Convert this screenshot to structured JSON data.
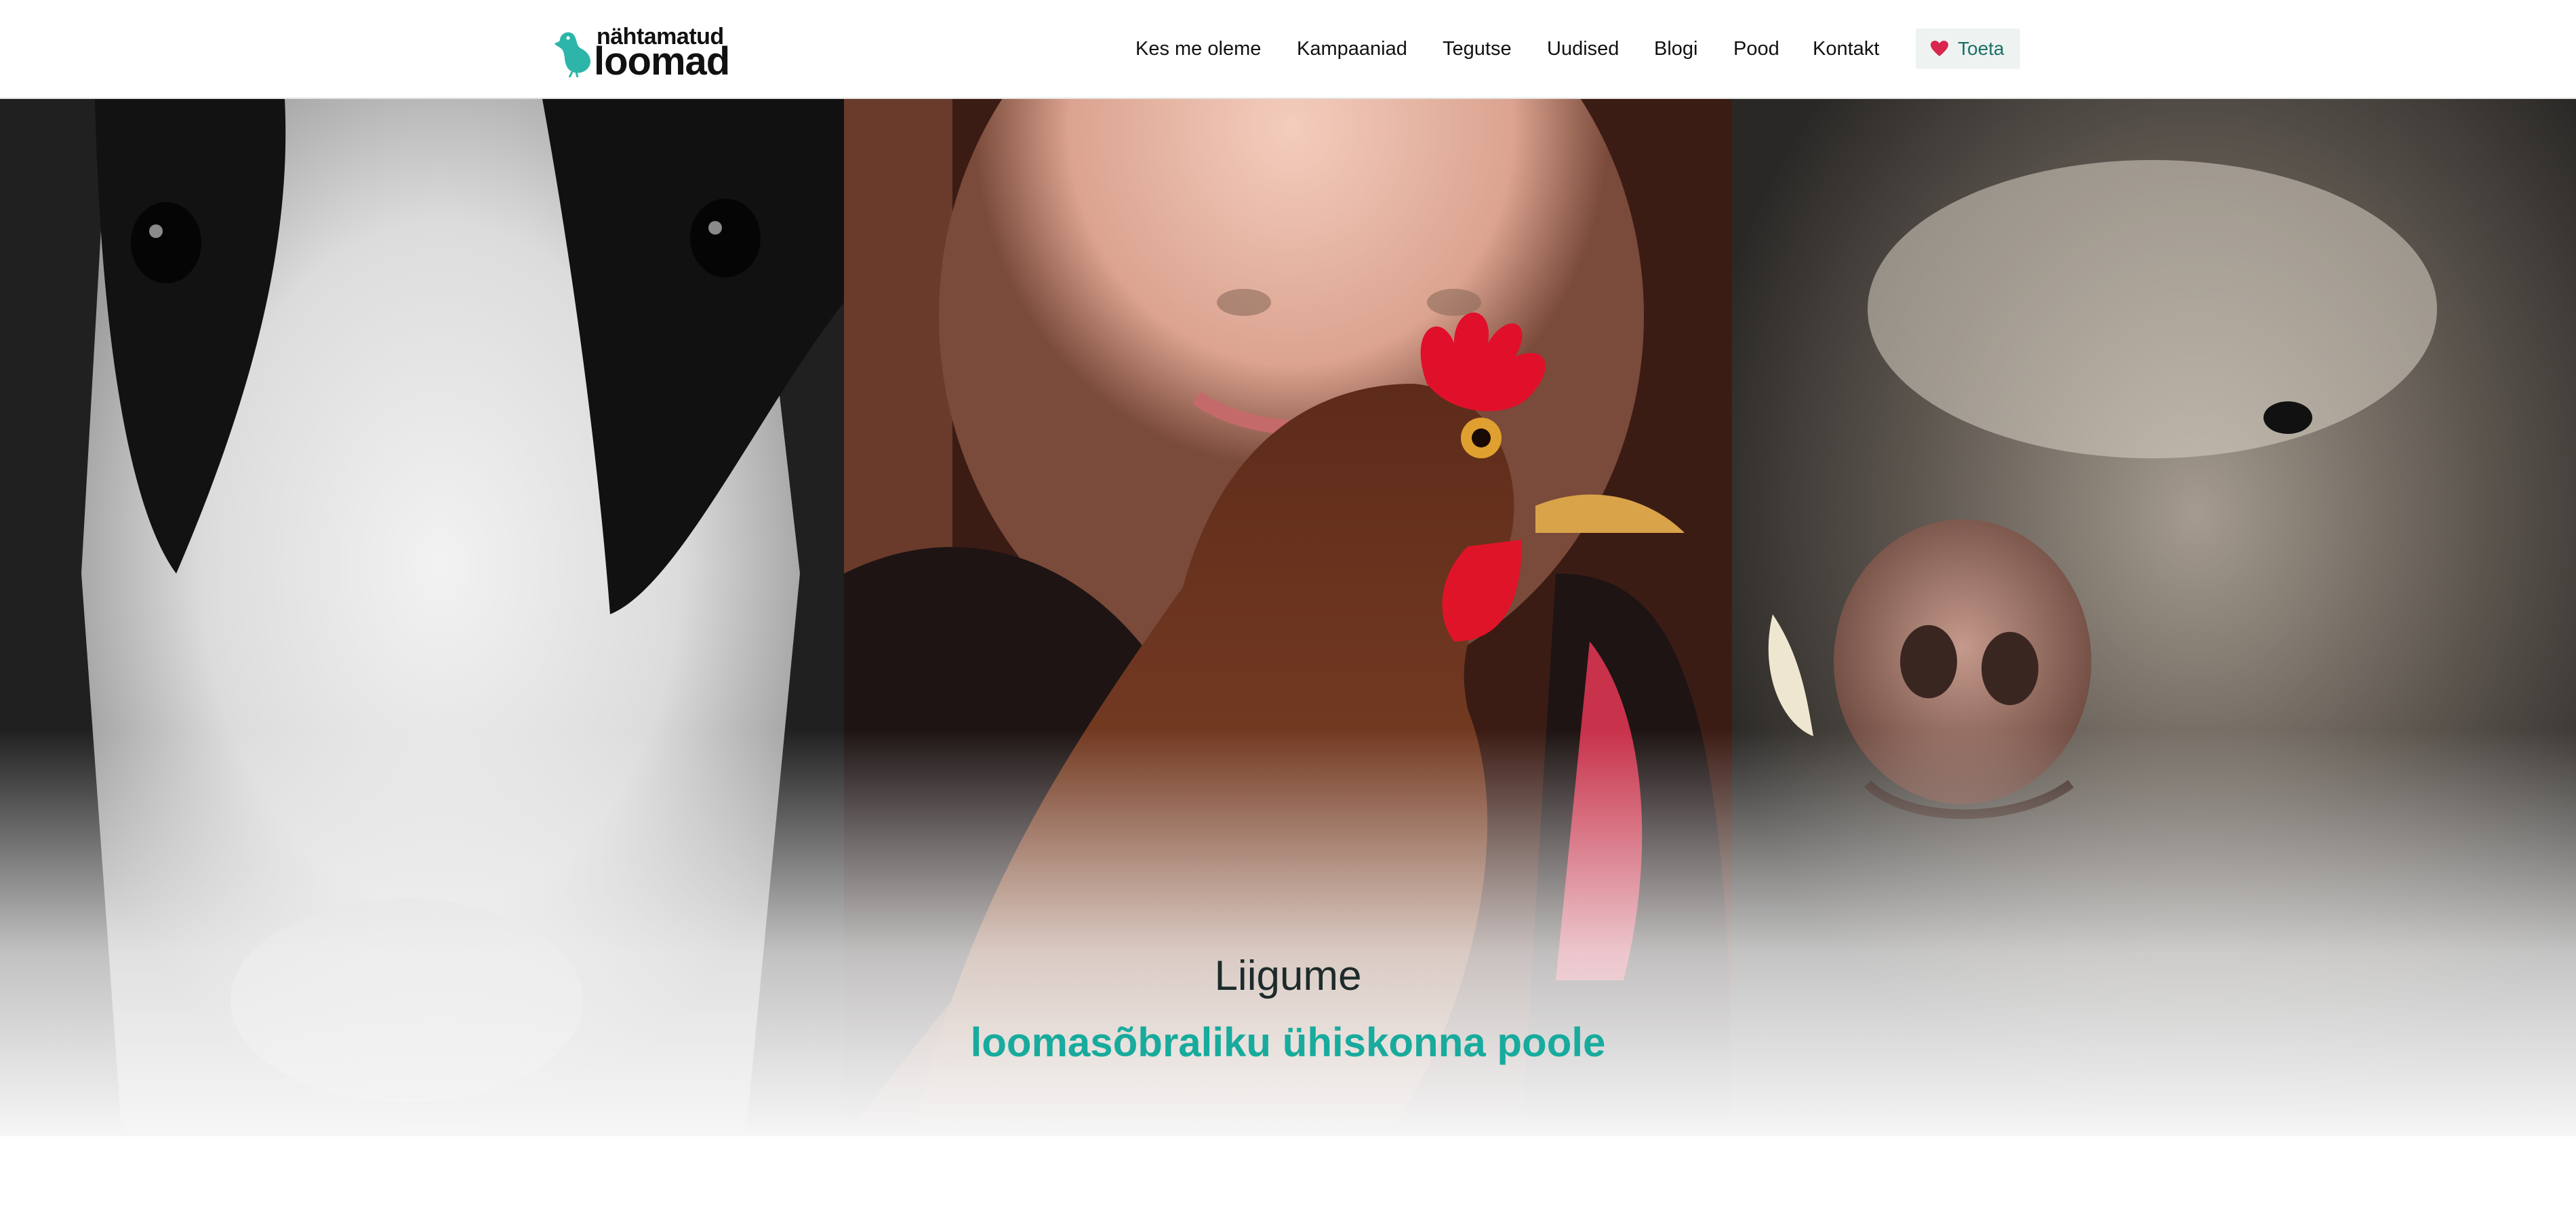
{
  "header": {
    "logo": {
      "line1": "nähtamatud",
      "line2": "loomad",
      "icon": "bird-icon"
    },
    "nav": [
      {
        "label": "Kes me oleme"
      },
      {
        "label": "Kampaaniad"
      },
      {
        "label": "Tegutse"
      },
      {
        "label": "Uudised"
      },
      {
        "label": "Blogi"
      },
      {
        "label": "Pood"
      },
      {
        "label": "Kontakt"
      }
    ],
    "donate": {
      "label": "Toeta",
      "icon": "heart-icon"
    }
  },
  "hero": {
    "title": "Liigume",
    "subtitle": "loomasõbraliku ühiskonna poole",
    "images": [
      "cow-photo",
      "hen-and-woman-photo",
      "pig-photo"
    ]
  },
  "colors": {
    "brand_teal": "#18ab9d",
    "heart_red": "#d8284d",
    "donate_bg": "#eef3f2",
    "text_dark": "#111111"
  }
}
